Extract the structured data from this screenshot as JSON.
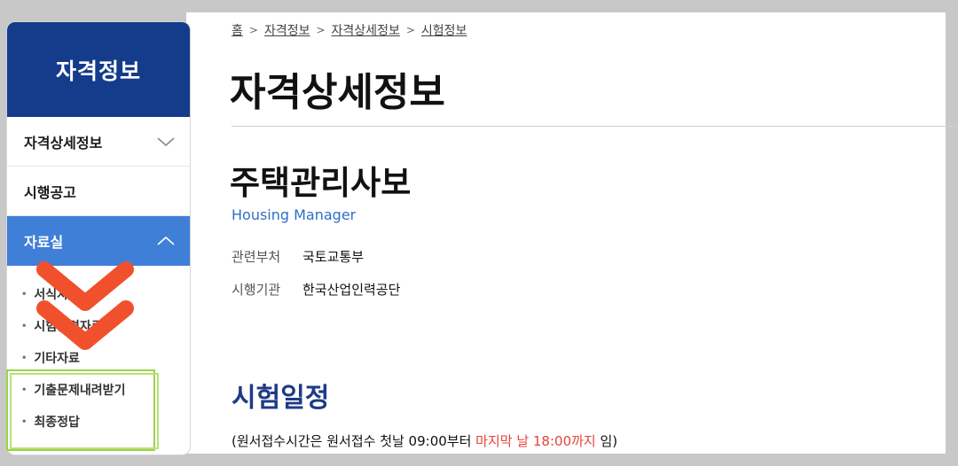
{
  "sidebar": {
    "header": "자격정보",
    "items": [
      {
        "label": "자격상세정보",
        "state": "collapsed"
      },
      {
        "label": "시행공고"
      },
      {
        "label": "자료실",
        "state": "expanded"
      }
    ],
    "sub_items": [
      {
        "label": "서식자료"
      },
      {
        "label": "시험관련자료"
      },
      {
        "label": "기타자료"
      },
      {
        "label": "기출문제내려받기"
      },
      {
        "label": "최종정답"
      }
    ]
  },
  "breadcrumb": [
    "홈",
    "자격정보",
    "자격상세정보",
    "시험정보"
  ],
  "page_title": "자격상세정보",
  "certificate": {
    "title": "주택관리사보",
    "english": "Housing Manager",
    "rows": [
      {
        "label": "관련부처",
        "value": "국토교통부"
      },
      {
        "label": "시행기관",
        "value": "한국산업인력공단"
      }
    ]
  },
  "schedule": {
    "title": "시험일정",
    "note_prefix": "(원서접수시간은 원서접수 첫날 09:00부터 ",
    "note_highlight": "마지막 날 18:00까지",
    "note_suffix": " 임)"
  },
  "colors": {
    "sidebar_header": "#143c8a",
    "active_item": "#3f7fd7",
    "english_name": "#2f6fc8",
    "section_title": "#1d3b86",
    "note_highlight": "#e8413a",
    "annotation_arrow": "#f0512c",
    "annotation_box": "#9bd34a"
  }
}
